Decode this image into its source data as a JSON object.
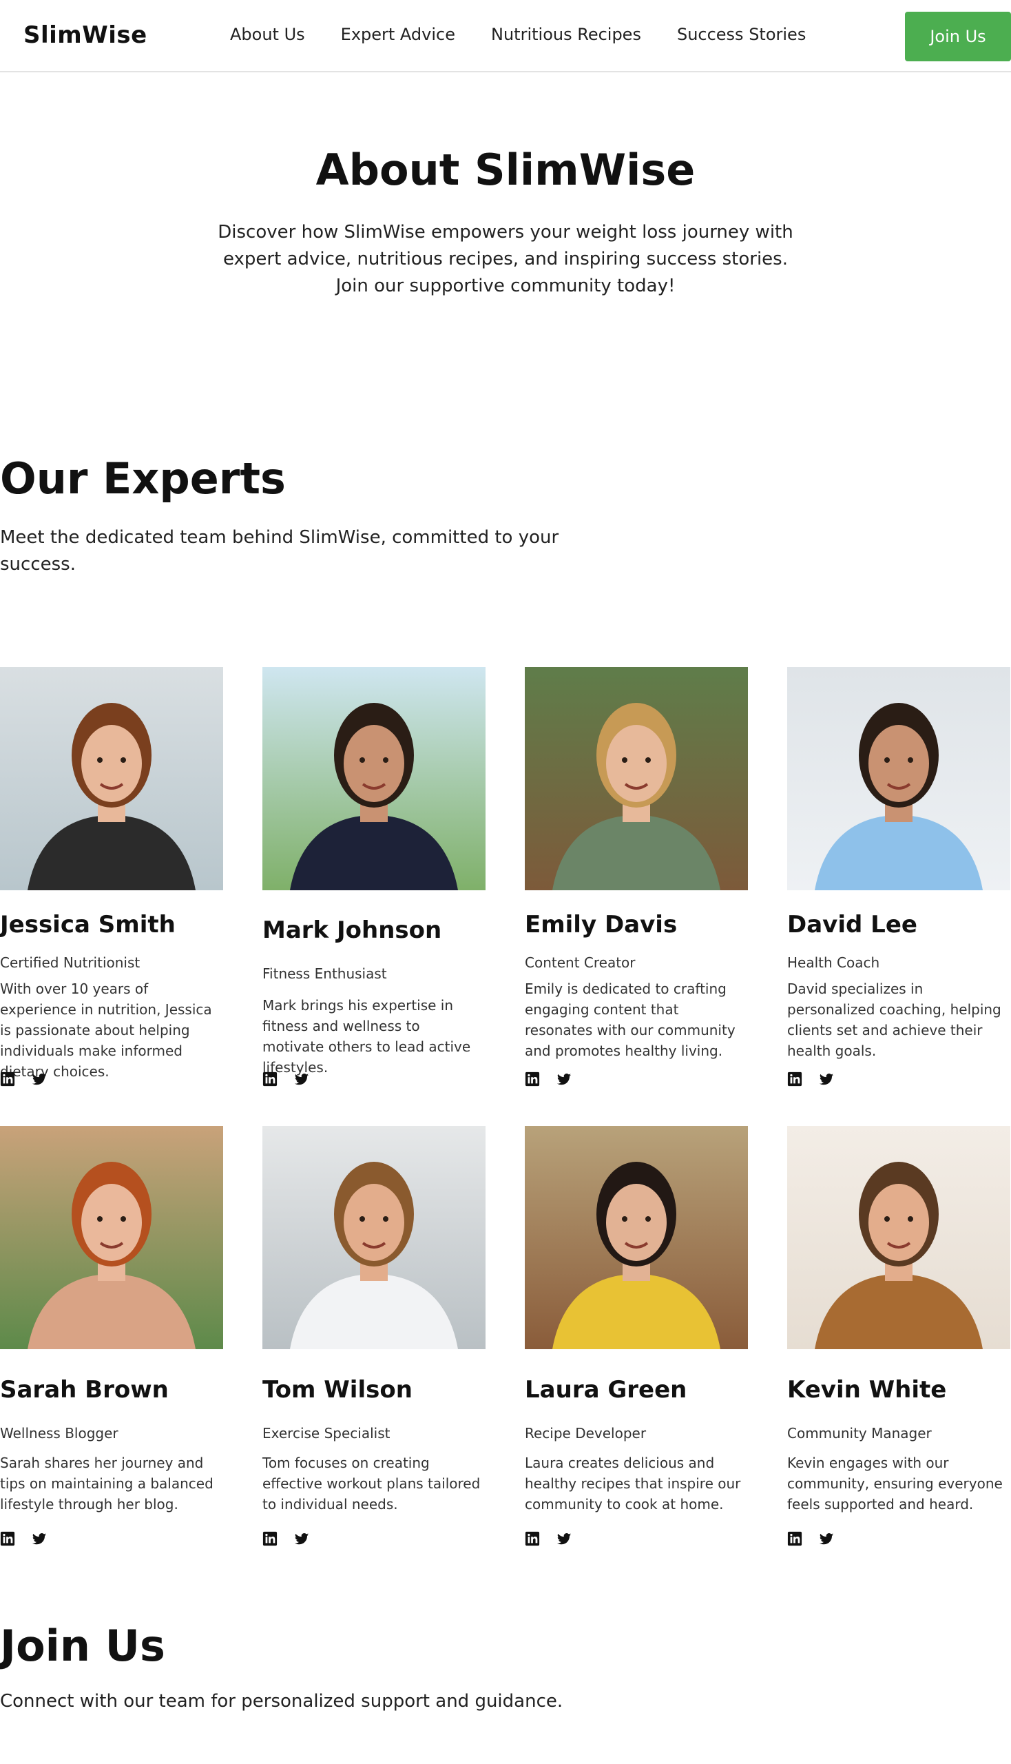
{
  "nav": {
    "logo": "SlimWise",
    "links": [
      "About Us",
      "Expert Advice",
      "Nutritious Recipes",
      "Success Stories"
    ],
    "join_label": "Join Us",
    "join_color": "#4cae50"
  },
  "hero": {
    "title": "About SlimWise",
    "text": "Discover how SlimWise empowers your weight loss journey with expert advice, nutritious recipes, and inspiring success stories. Join our supportive community today!"
  },
  "experts": {
    "title": "Our Experts",
    "text": "Meet the dedicated team behind SlimWise, committed to your success.",
    "members": [
      {
        "name": "Jessica Smith",
        "role": "Certified Nutritionist",
        "bio": "With over 10 years of experience in nutrition, Jessica is passionate about helping individuals make informed dietary choices."
      },
      {
        "name": "Mark Johnson",
        "role": "Fitness Enthusiast",
        "bio": "Mark brings his expertise in fitness and wellness to motivate others to lead active lifestyles."
      },
      {
        "name": "Emily Davis",
        "role": "Content Creator",
        "bio": "Emily is dedicated to crafting engaging content that resonates with our community and promotes healthy living."
      },
      {
        "name": "David Lee",
        "role": "Health Coach",
        "bio": "David specializes in personalized coaching, helping clients set and achieve their health goals."
      },
      {
        "name": "Sarah Brown",
        "role": "Wellness Blogger",
        "bio": "Sarah shares her journey and tips on maintaining a balanced lifestyle through her blog."
      },
      {
        "name": "Tom Wilson",
        "role": "Exercise Specialist",
        "bio": "Tom focuses on creating effective workout plans tailored to individual needs."
      },
      {
        "name": "Laura Green",
        "role": "Recipe Developer",
        "bio": "Laura creates delicious and healthy recipes that inspire our community to cook at home."
      },
      {
        "name": "Kevin White",
        "role": "Community Manager",
        "bio": "Kevin engages with our community, ensuring everyone feels supported and heard."
      }
    ],
    "social_icons": [
      "linkedin-icon",
      "twitter-icon"
    ]
  },
  "join": {
    "title": "Join Us",
    "text": "Connect with our team for personalized support and guidance."
  }
}
